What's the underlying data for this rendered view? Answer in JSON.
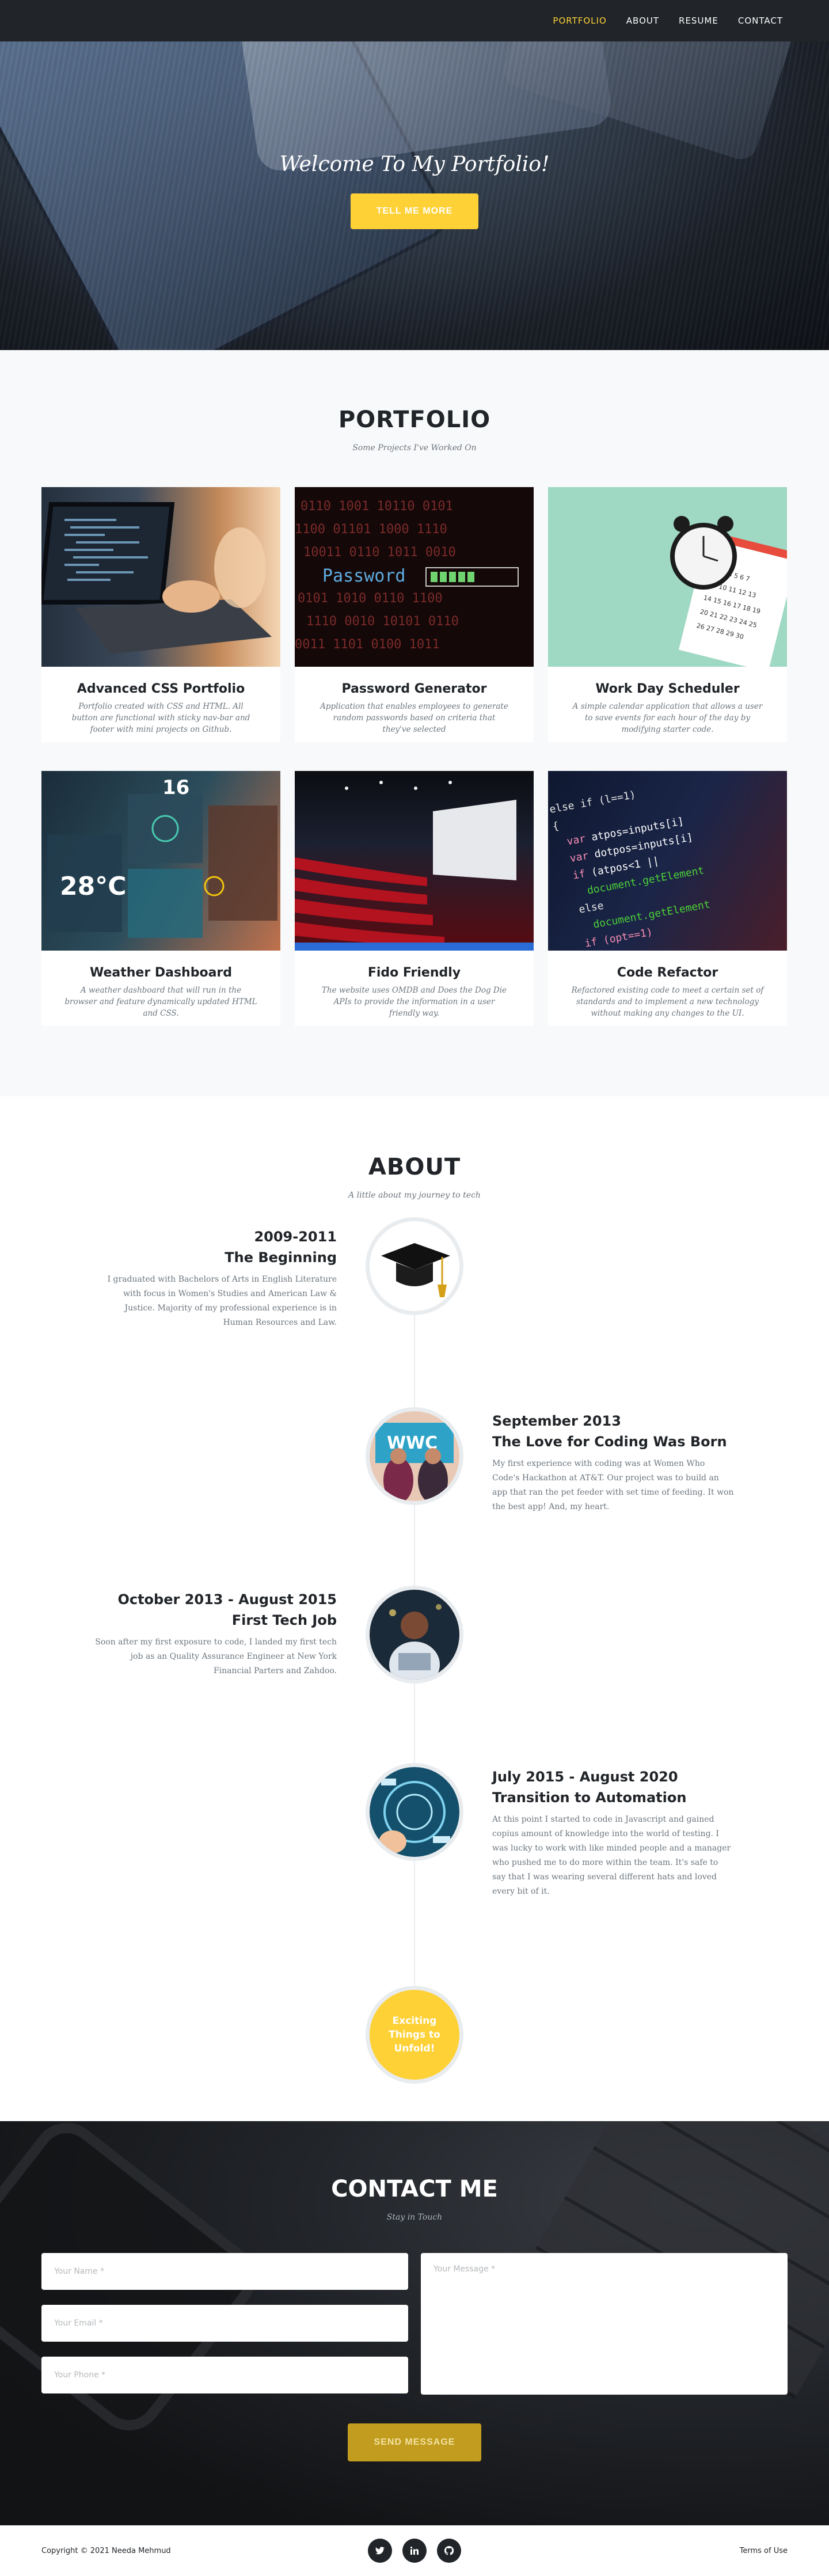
{
  "nav": {
    "links": [
      "PORTFOLIO",
      "ABOUT",
      "RESUME",
      "CONTACT"
    ],
    "active": "PORTFOLIO"
  },
  "hero": {
    "heading": "Welcome To My Portfolio!",
    "button": "TELL ME MORE"
  },
  "portfolio": {
    "title": "PORTFOLIO",
    "subtitle": "Some Projects I've Worked On",
    "items": [
      {
        "title": "Advanced CSS Portfolio",
        "desc": "Portfolio created with CSS and HTML. All button are functional with sticky nav-bar and footer with mini projects on Github."
      },
      {
        "title": "Password Generator",
        "desc": "Application that enables employees to generate random passwords based on criteria that they've selected",
        "image_text": "Password"
      },
      {
        "title": "Work Day Scheduler",
        "desc": "A simple calendar application that allows a user to save events for each hour of the day by modifying starter code."
      },
      {
        "title": "Weather Dashboard",
        "desc": "A weather dashboard that will run in the browser and feature dynamically updated HTML and CSS.",
        "image_text": "28°C"
      },
      {
        "title": "Fido Friendly",
        "desc": "The website uses OMDB and Does the Dog Die APIs to provide the information in a user friendly way."
      },
      {
        "title": "Code Refactor",
        "desc": "Refactored existing code to meet a certain set of standards and to implement a new technology without making any changes to the UI."
      }
    ]
  },
  "about": {
    "title": "ABOUT",
    "subtitle": "A little about my journey to tech",
    "timeline": [
      {
        "date": "2009-2011",
        "title": "The Beginning",
        "text": "I graduated with Bachelors of Arts in English Literature with focus in Women's Studies and American Law & Justice. Majority of my professional experience is in Human Resources and Law."
      },
      {
        "date": "September 2013",
        "title": "The Love for Coding Was Born",
        "text": "My first experience with coding was at Women Who Code's Hackathon at AT&T. Our project was to build an app that ran the pet feeder with set time of feeding. It won the best app! And, my heart."
      },
      {
        "date": "October 2013 - August 2015",
        "title": "First Tech Job",
        "text": "Soon after my first exposure to code, I landed my first tech job as an Quality Assurance Engineer at New York Financial Parters and Zahdoo."
      },
      {
        "date": "July 2015 - August 2020",
        "title": "Transition to Automation",
        "text": "At this point I started to code in Javascript and gained copius amount of knowledge into the world of testing. I was lucky to work with like minded people and a manager who pushed me to do more within the team. It's safe to say that I was wearing several different hats and loved every bit of it."
      }
    ],
    "final": "Exciting Things to Unfold!"
  },
  "contact": {
    "title": "CONTACT ME",
    "subtitle": "Stay in Touch",
    "name_placeholder": "Your Name *",
    "email_placeholder": "Your Email *",
    "phone_placeholder": "Your Phone *",
    "message_placeholder": "Your Message *",
    "button": "SEND MESSAGE"
  },
  "footer": {
    "copyright": "Copyright © 2021 Needa Mehmud",
    "socials": [
      "twitter-icon",
      "linkedin-icon",
      "github-icon"
    ],
    "terms": "Terms of Use"
  },
  "colors": {
    "accent": "#fed136",
    "dark": "#212529"
  }
}
